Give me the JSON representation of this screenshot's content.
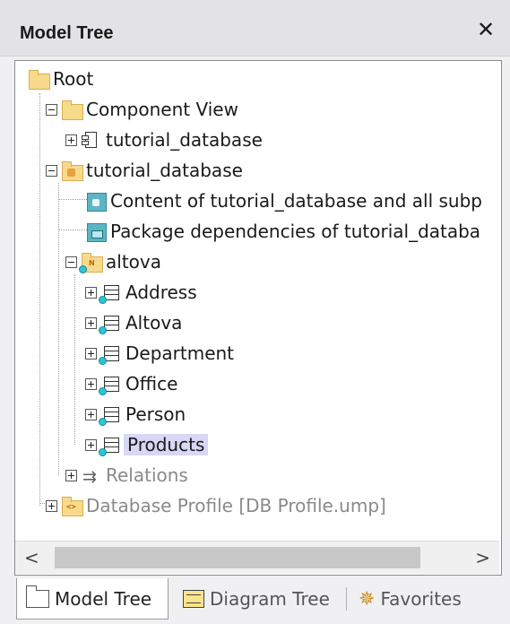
{
  "panel": {
    "title": "Model Tree",
    "close_glyph": "✕"
  },
  "tree": {
    "root": "Root",
    "component_view": "Component View",
    "component_view_child": "tutorial_database",
    "package": "tutorial_database",
    "content_diagram": "Content of tutorial_database and all subp",
    "package_dep_diagram": "Package dependencies of tutorial_databa",
    "namespace": "altova",
    "tables": [
      "Address",
      "Altova",
      "Department",
      "Office",
      "Person",
      "Products"
    ],
    "selected_table": "Products",
    "relations": "Relations",
    "db_profile": "Database Profile [DB Profile.ump]"
  },
  "scrollbar": {
    "left_arrow": "<",
    "right_arrow": ">"
  },
  "tabs": [
    {
      "label": "Model Tree",
      "icon": "folder-icon",
      "active": true
    },
    {
      "label": "Diagram Tree",
      "icon": "diagram-tree-icon",
      "active": false
    },
    {
      "label": "Favorites",
      "icon": "favorites-star-icon",
      "active": false
    }
  ],
  "colors": {
    "selection": "#d7d7f6",
    "folder": "#f8da8c",
    "namespace_dot": "#2ec4d6",
    "diagram": "#5db5c4"
  }
}
